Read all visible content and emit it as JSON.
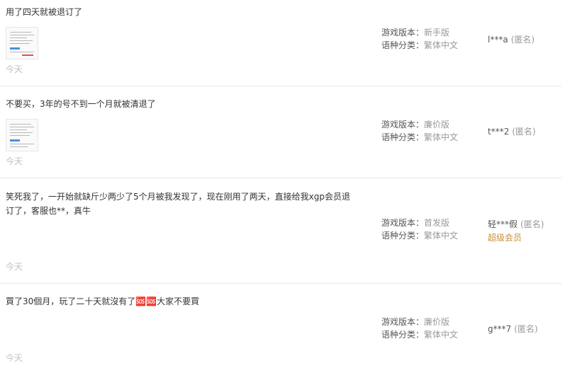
{
  "reviews": [
    {
      "content": "用了四天就被退订了",
      "date": "今天",
      "version_label": "游戏版本：",
      "version": "新手版",
      "language_label": "语种分类：",
      "language": "繁体中文",
      "user": "l***a",
      "anon": "(匿名)",
      "has_image": true
    },
    {
      "content": "不要买，3年的号不到一个月就被清退了",
      "date": "今天",
      "version_label": "游戏版本：",
      "version": "廉价版",
      "language_label": "语种分类：",
      "language": "繁体中文",
      "user": "t***2",
      "anon": "(匿名)",
      "has_image": true
    },
    {
      "content": "笑死我了，一开始就缺斤少两少了5个月被我发现了，现在刚用了两天，直接给我xgp会员退\n订了，客服也**，真牛",
      "date": "今天",
      "version_label": "游戏版本：",
      "version": "首发版",
      "language_label": "语种分类：",
      "language": "繁体中文",
      "user": "轻***假",
      "anon": "(匿名)",
      "badge": "超级会员",
      "has_image": false
    },
    {
      "content": "買了30個月，玩了二十天就沒有了🆘🆘大家不要買",
      "date": "今天",
      "version_label": "游戏版本：",
      "version": "廉价版",
      "language_label": "语种分类：",
      "language": "繁体中文",
      "user": "g***7",
      "anon": "(匿名)",
      "has_image": false
    }
  ],
  "colors": {
    "text": "#333333",
    "muted": "#999999",
    "date": "#c0c0c0",
    "vip": "#c8913a",
    "divider": "#e8e8e8"
  }
}
